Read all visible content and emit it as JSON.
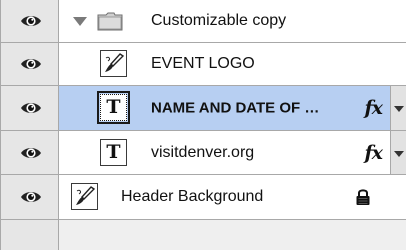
{
  "layers_panel": {
    "layers": [
      {
        "name": "Customizable copy",
        "kind": "group",
        "icon": "folder-icon",
        "expanded": true,
        "visible": true
      },
      {
        "name": "EVENT LOGO",
        "kind": "smart-object",
        "icon": "brush-thumbnail-icon",
        "visible": true
      },
      {
        "name": "NAME AND DATE OF …",
        "kind": "text",
        "thumb_glyph": "T",
        "selected": true,
        "has_effects": true,
        "fx_label": "fx",
        "visible": true
      },
      {
        "name": "visitdenver.org",
        "kind": "text",
        "thumb_glyph": "T",
        "has_effects": true,
        "fx_label": "fx",
        "visible": true
      },
      {
        "name": "Header Background",
        "kind": "smart-object",
        "icon": "brush-thumbnail-icon",
        "locked": true,
        "visible": true
      }
    ]
  },
  "colors": {
    "selection": "#b7cff2",
    "eye_column": "#e6e6e6",
    "row_background": "#ffffff",
    "divider": "#a8a8a8"
  }
}
